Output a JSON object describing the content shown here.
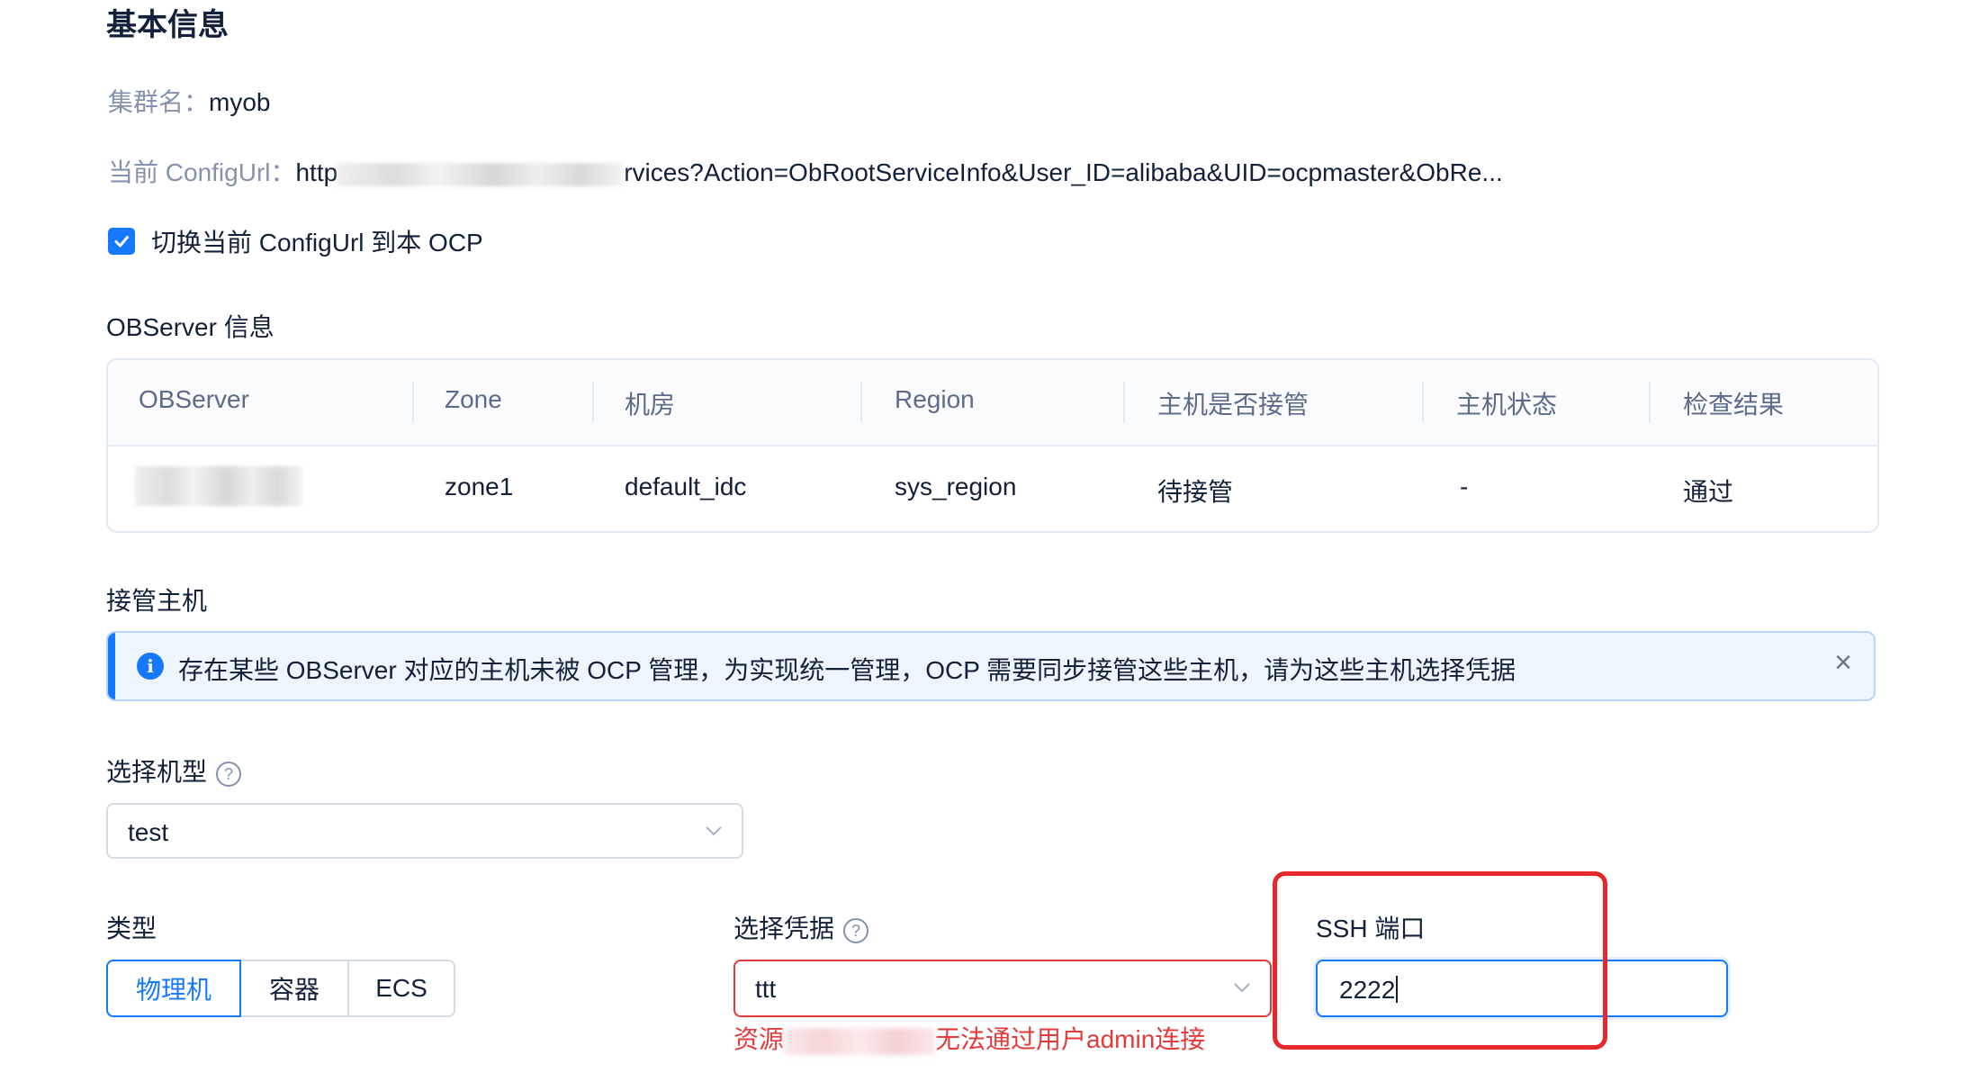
{
  "basic_info": {
    "title": "基本信息",
    "cluster_name_label": "集群名：",
    "cluster_name_value": "myob",
    "config_url_label": "当前 ConfigUrl：",
    "config_url_prefix": "http",
    "config_url_suffix": "rvices?Action=ObRootServiceInfo&User_ID=alibaba&UID=ocpmaster&ObRe...",
    "switch_checkbox_label": "切换当前 ConfigUrl 到本 OCP"
  },
  "observer_info": {
    "title": "OBServer 信息",
    "columns": [
      "OBServer",
      "Zone",
      "机房",
      "Region",
      "主机是否接管",
      "主机状态",
      "检查结果"
    ],
    "rows": [
      {
        "zone": "zone1",
        "idc": "default_idc",
        "region": "sys_region",
        "managed": "待接管",
        "status": "-",
        "result": "通过"
      }
    ]
  },
  "takeover": {
    "title": "接管主机",
    "alert_text": "存在某些 OBServer 对应的主机未被 OCP 管理，为实现统一管理，OCP 需要同步接管这些主机，请为这些主机选择凭据",
    "alert_icon": "info-icon",
    "close_icon": "close-icon",
    "close_glyph": "×"
  },
  "form": {
    "model_label": "选择机型",
    "model_value": "test",
    "type_label": "类型",
    "type_options": [
      "物理机",
      "容器",
      "ECS"
    ],
    "type_selected": "物理机",
    "credential_label": "选择凭据",
    "credential_value": "ttt",
    "credential_error_prefix": "资源",
    "credential_error_suffix": "无法通过用户admin连接",
    "ssh_port_label": "SSH 端口",
    "ssh_port_value": "2222"
  },
  "colors": {
    "primary": "#1677ff",
    "error": "#e23b3b",
    "highlight": "#e8282d"
  }
}
